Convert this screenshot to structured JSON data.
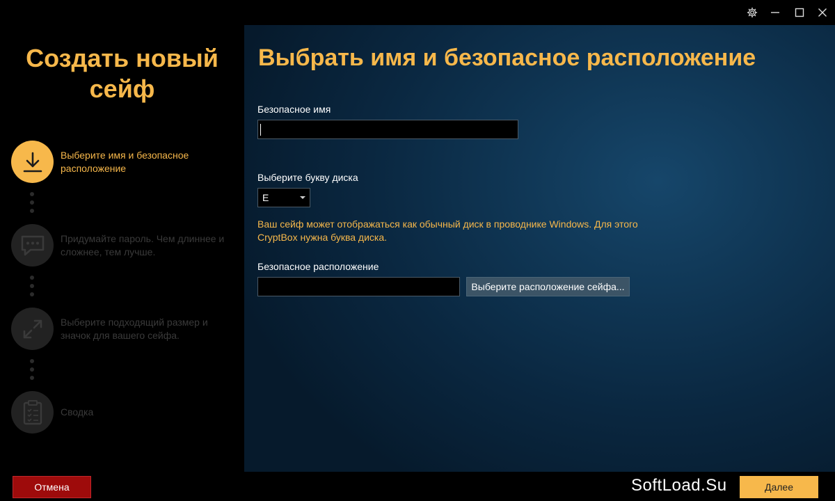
{
  "window": {
    "settings_icon": "gear-icon",
    "minimize_icon": "minimize-icon",
    "maximize_icon": "maximize-icon",
    "close_icon": "close-icon"
  },
  "sidebar": {
    "title": "Создать новый сейф",
    "steps": [
      {
        "label": "Выберите имя и безопасное расположение",
        "icon": "download-icon",
        "active": true
      },
      {
        "label": "Придумайте пароль. Чем длиннее и сложнее, тем лучше.",
        "icon": "chat-icon",
        "active": false
      },
      {
        "label": "Выберите подходящий размер и значок для вашего сейфа.",
        "icon": "resize-icon",
        "active": false
      },
      {
        "label": "Сводка",
        "icon": "clipboard-icon",
        "active": false
      }
    ]
  },
  "main": {
    "title": "Выбрать имя и безопасное расположение",
    "safe_name_label": "Безопасное имя",
    "safe_name_value": "",
    "drive_letter_label": "Выберите букву диска",
    "drive_letter_value": "E",
    "drive_note": "Ваш сейф может отображаться как обычный диск в проводнике Windows. Для этого CryptBox нужна буква диска.",
    "location_label": "Безопасное расположение",
    "location_value": "",
    "browse_button": "Выберите расположение сейфа..."
  },
  "footer": {
    "cancel_button": "Отмена",
    "watermark": "SoftLoad.Su",
    "next_button": "Далее"
  },
  "colors": {
    "accent": "#f7b84b",
    "cancel": "#9e0b0b",
    "panel_bg": "#0f3553"
  }
}
